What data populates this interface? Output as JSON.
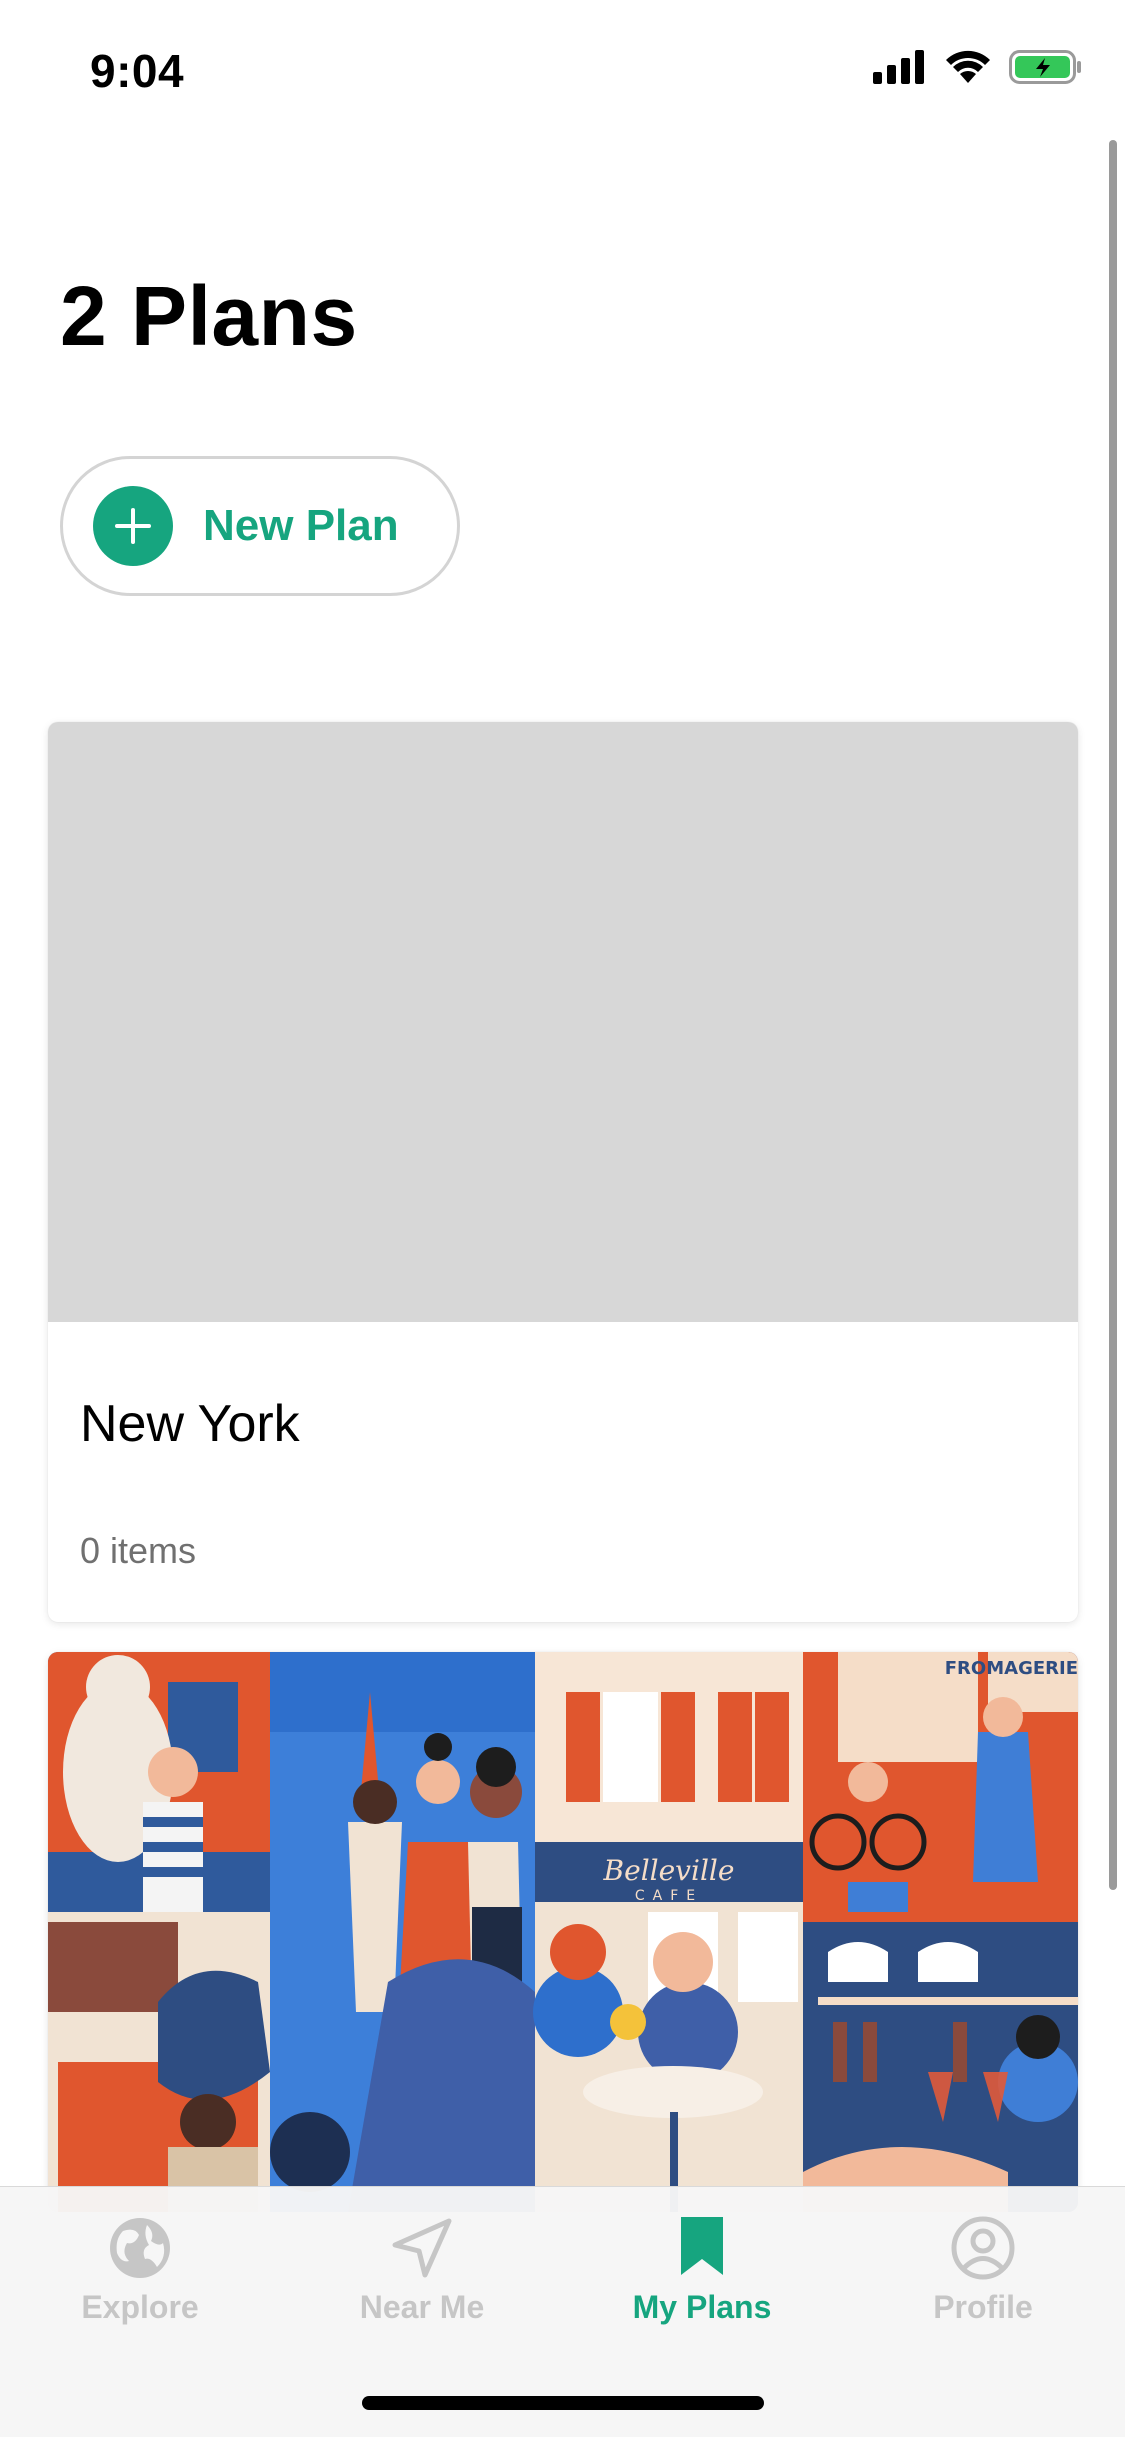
{
  "status_bar": {
    "time": "9:04",
    "icons": [
      "cellular-signal-icon",
      "wifi-icon",
      "battery-charging-icon"
    ],
    "battery_color": "#34c759"
  },
  "page": {
    "title": "2 Plans"
  },
  "new_plan": {
    "label": "New Plan",
    "icon": "plus-icon",
    "accent_color": "#16a57f"
  },
  "plans": [
    {
      "name": "New York",
      "count": "0 items",
      "image": "placeholder"
    },
    {
      "image": "illustrated-paris-street-scene",
      "sign_text": "Belleville",
      "sign_subtext": "CAFE",
      "shop_text": "FROMAGERIE"
    }
  ],
  "tab_bar": {
    "tabs": [
      {
        "label": "Explore",
        "icon": "globe-icon",
        "active": false
      },
      {
        "label": "Near Me",
        "icon": "navigation-arrow-icon",
        "active": false
      },
      {
        "label": "My Plans",
        "icon": "bookmark-icon",
        "active": true
      },
      {
        "label": "Profile",
        "icon": "user-circle-icon",
        "active": false
      }
    ],
    "active_color": "#16a57f",
    "inactive_color": "#c6c6c6"
  }
}
